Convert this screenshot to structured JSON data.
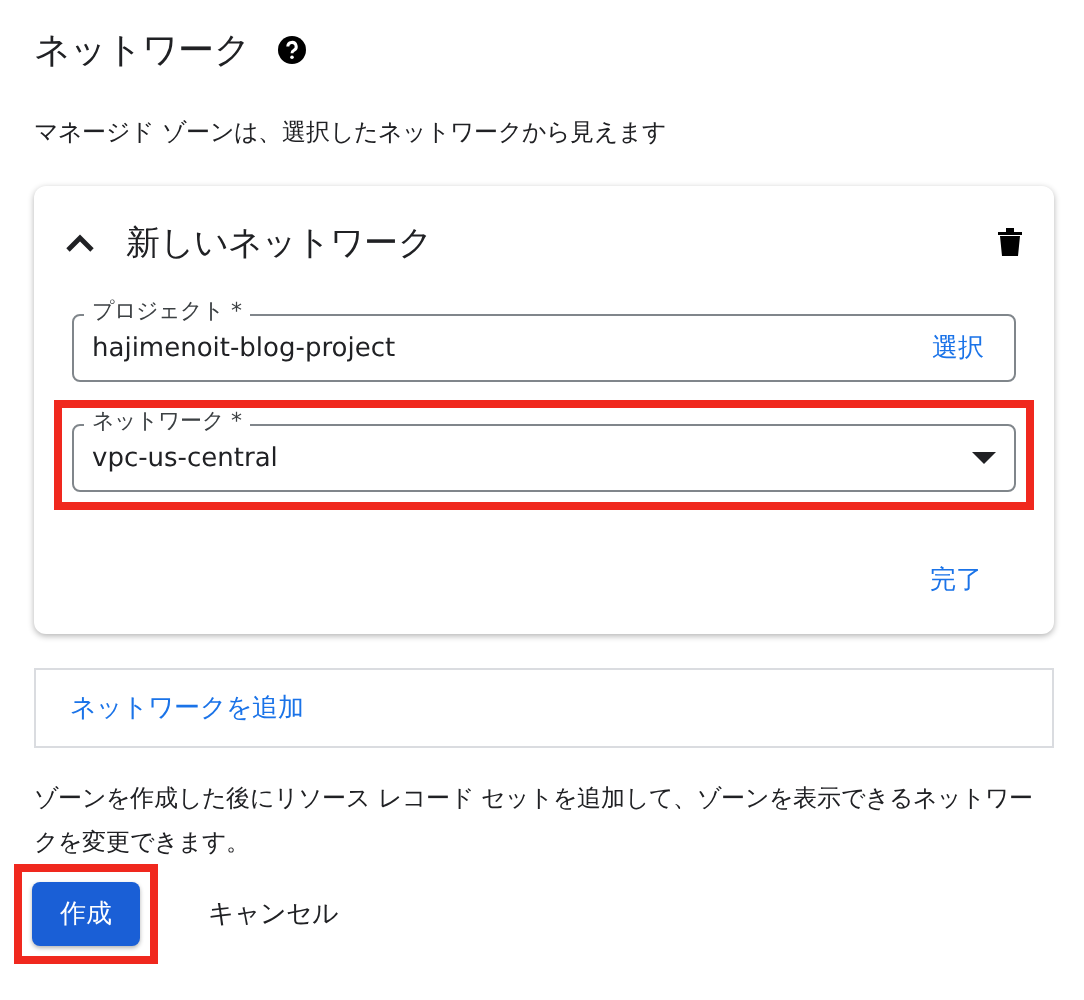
{
  "title": "ネットワーク",
  "subtitle": "マネージド ゾーンは、選択したネットワークから見えます",
  "card": {
    "title": "新しいネットワーク",
    "expanded": true,
    "fields": [
      {
        "kind": "text",
        "label": "プロジェクト *",
        "value": "hajimenoit-blog-project",
        "action": "選択",
        "highlighted": false
      },
      {
        "kind": "dropdown",
        "label": "ネットワーク *",
        "value": "vpc-us-central",
        "highlighted": true
      }
    ],
    "done": "完了"
  },
  "add_network": "ネットワークを追加",
  "note": "ゾーンを作成した後にリソース レコード セットを追加して、ゾーンを表示できるネットワークを変更できます。",
  "buttons": [
    {
      "kind": "primary",
      "label": "作成",
      "highlighted": true
    },
    {
      "kind": "text",
      "label": "キャンセル",
      "highlighted": false
    }
  ]
}
